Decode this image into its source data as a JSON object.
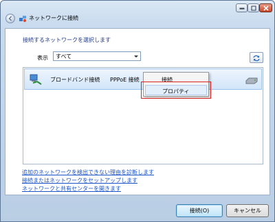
{
  "window": {
    "title": "ネットワークに接続"
  },
  "content": {
    "heading": "接続するネットワークを選択します",
    "show_label": "表示",
    "show_select": "すべて"
  },
  "network_list": {
    "items": [
      {
        "name": "ブロードバンド接続",
        "type": "PPPoE 接続"
      }
    ]
  },
  "context_menu": {
    "items": [
      "接続",
      "プロパティ"
    ],
    "highlight_color": "#d82020"
  },
  "links": [
    "追加のネットワークを検出できない理由を診断します",
    "接続またはネットワークをセットアップします",
    "ネットワークと共有センターを開きます"
  ],
  "buttons": {
    "connect": "接続(O)",
    "cancel": "キャンセル"
  },
  "icons": {
    "back": "back-arrow-icon",
    "app": "network-connect-icon",
    "refresh": "refresh-icon",
    "network": "broadband-network-icon",
    "modem": "modem-icon"
  }
}
